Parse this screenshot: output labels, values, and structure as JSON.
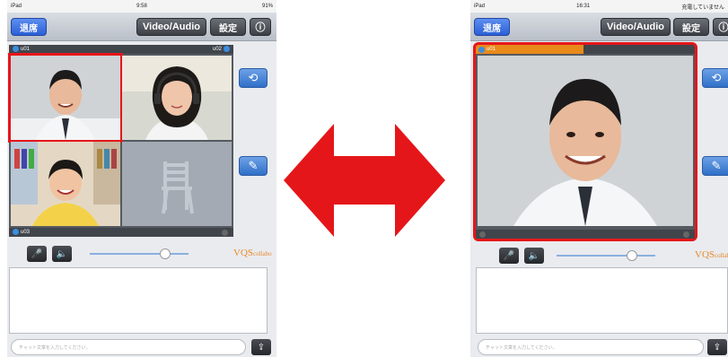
{
  "left": {
    "status": {
      "carrier": "iPad",
      "time": "9:58",
      "battery": "91%"
    },
    "navbar": {
      "exit_label": "退席",
      "va_label": "Video/Audio",
      "settings_label": "設定",
      "info_label": "ⓘ"
    },
    "tiles": [
      {
        "label": "u01"
      },
      {
        "label": "u02"
      },
      {
        "label": "u03"
      },
      {
        "label": ""
      }
    ],
    "brand": "VQS",
    "brand_suffix": "collabo",
    "chat_placeholder": "チャット文章を入力してください。"
  },
  "right": {
    "status": {
      "carrier": "iPad",
      "time": "16:31",
      "battery": "充電していません"
    },
    "navbar": {
      "exit_label": "退席",
      "va_label": "Video/Audio",
      "settings_label": "設定",
      "info_label": "ⓘ"
    },
    "tile_label": "u01",
    "brand": "VQS",
    "brand_suffix": "collabo",
    "chat_placeholder": "チャット文章を入力してください。"
  },
  "colors": {
    "highlight": "#e5161a",
    "arrow": "#e5161a",
    "exit_button": "#2b5fd8",
    "active_bar": "#e88a1a"
  }
}
